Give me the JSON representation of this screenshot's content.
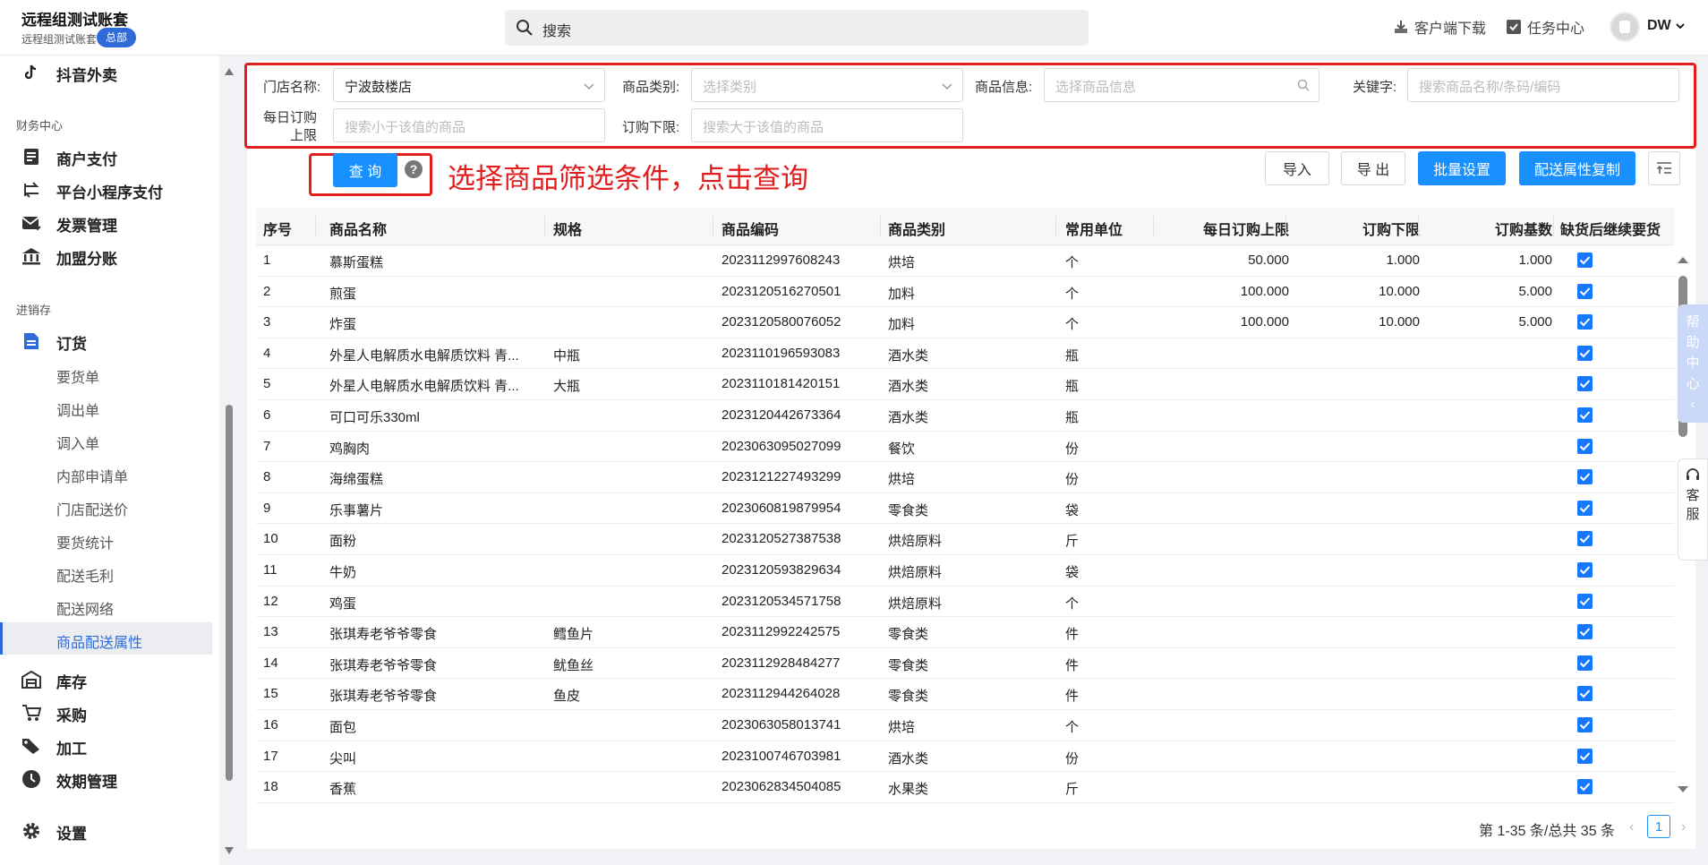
{
  "account": {
    "name": "远程组测试账套",
    "sub": "远程组测试账套",
    "badge": "总部"
  },
  "search": {
    "placeholder": "搜索"
  },
  "top_actions": {
    "download": "客户端下载",
    "tasks": "任务中心",
    "user": "DW"
  },
  "sidebar": {
    "items_top": [
      {
        "label": "抖音外卖",
        "icon": "tiktok-icon"
      }
    ],
    "section_finance": "财务中心",
    "finance": [
      {
        "label": "商户支付",
        "icon": "receipt-icon"
      },
      {
        "label": "平台小程序支付",
        "icon": "swap-icon"
      },
      {
        "label": "发票管理",
        "icon": "envelope-icon"
      },
      {
        "label": "加盟分账",
        "icon": "bank-icon"
      }
    ],
    "section_inventory": "进销存",
    "order": {
      "label": "订货",
      "icon": "document-icon"
    },
    "order_sub": [
      "要货单",
      "调出单",
      "调入单",
      "内部申请单",
      "门店配送价",
      "要货统计",
      "配送毛利",
      "配送网络",
      "商品配送属性"
    ],
    "active_sub": "商品配送属性",
    "bottom": [
      {
        "label": "库存",
        "icon": "warehouse-icon"
      },
      {
        "label": "采购",
        "icon": "cart-icon"
      },
      {
        "label": "加工",
        "icon": "tag-icon"
      },
      {
        "label": "效期管理",
        "icon": "clock-icon"
      }
    ],
    "settings": {
      "label": "设置",
      "icon": "gear-icon"
    }
  },
  "filters": {
    "store_label": "门店名称:",
    "store_value": "宁波鼓楼店",
    "category_label": "商品类别:",
    "category_placeholder": "选择类别",
    "info_label": "商品信息:",
    "info_placeholder": "选择商品信息",
    "keyword_label": "关键字:",
    "keyword_placeholder": "搜索商品名称/条码/编码",
    "daily_label_1": "每日订购",
    "daily_label_2": "上限",
    "daily_placeholder": "搜索小于该值的商品",
    "min_label": "订购下限:",
    "min_placeholder": "搜索大于该值的商品"
  },
  "toolbar": {
    "query": "查 询",
    "help": "?",
    "hint": "选择商品筛选条件，点击查询",
    "import": "导入",
    "export": "导 出",
    "batch": "批量设置",
    "copy": "配送属性复制"
  },
  "table": {
    "headers": [
      "序号",
      "商品名称",
      "规格",
      "商品编码",
      "商品类别",
      "常用单位",
      "每日订购上限",
      "订购下限",
      "订购基数",
      "缺货后继续要货"
    ],
    "rows": [
      {
        "no": "1",
        "name": "慕斯蛋糕",
        "spec": "",
        "code": "2023112997608243",
        "cat": "烘培",
        "unit": "个",
        "daily": "50.000",
        "min": "1.000",
        "base": "1.000"
      },
      {
        "no": "2",
        "name": "煎蛋",
        "spec": "",
        "code": "2023120516270501",
        "cat": "加料",
        "unit": "个",
        "daily": "100.000",
        "min": "10.000",
        "base": "5.000"
      },
      {
        "no": "3",
        "name": "炸蛋",
        "spec": "",
        "code": "2023120580076052",
        "cat": "加料",
        "unit": "个",
        "daily": "100.000",
        "min": "10.000",
        "base": "5.000"
      },
      {
        "no": "4",
        "name": "外星人电解质水电解质饮料 青...",
        "spec": "中瓶",
        "code": "2023110196593083",
        "cat": "酒水类",
        "unit": "瓶",
        "daily": "",
        "min": "",
        "base": ""
      },
      {
        "no": "5",
        "name": "外星人电解质水电解质饮料 青...",
        "spec": "大瓶",
        "code": "2023110181420151",
        "cat": "酒水类",
        "unit": "瓶",
        "daily": "",
        "min": "",
        "base": ""
      },
      {
        "no": "6",
        "name": "可口可乐330ml",
        "spec": "",
        "code": "2023120442673364",
        "cat": "酒水类",
        "unit": "瓶",
        "daily": "",
        "min": "",
        "base": ""
      },
      {
        "no": "7",
        "name": "鸡胸肉",
        "spec": "",
        "code": "2023063095027099",
        "cat": "餐饮",
        "unit": "份",
        "daily": "",
        "min": "",
        "base": ""
      },
      {
        "no": "8",
        "name": "海绵蛋糕",
        "spec": "",
        "code": "2023121227493299",
        "cat": "烘培",
        "unit": "份",
        "daily": "",
        "min": "",
        "base": ""
      },
      {
        "no": "9",
        "name": "乐事薯片",
        "spec": "",
        "code": "2023060819879954",
        "cat": "零食类",
        "unit": "袋",
        "daily": "",
        "min": "",
        "base": ""
      },
      {
        "no": "10",
        "name": "面粉",
        "spec": "",
        "code": "2023120527387538",
        "cat": "烘焙原料",
        "unit": "斤",
        "daily": "",
        "min": "",
        "base": ""
      },
      {
        "no": "11",
        "name": "牛奶",
        "spec": "",
        "code": "2023120593829634",
        "cat": "烘焙原料",
        "unit": "袋",
        "daily": "",
        "min": "",
        "base": ""
      },
      {
        "no": "12",
        "name": "鸡蛋",
        "spec": "",
        "code": "2023120534571758",
        "cat": "烘焙原料",
        "unit": "个",
        "daily": "",
        "min": "",
        "base": ""
      },
      {
        "no": "13",
        "name": "张琪寿老爷爷零食",
        "spec": "鳕鱼片",
        "code": "2023112992242575",
        "cat": "零食类",
        "unit": "件",
        "daily": "",
        "min": "",
        "base": ""
      },
      {
        "no": "14",
        "name": "张琪寿老爷爷零食",
        "spec": "鱿鱼丝",
        "code": "2023112928484277",
        "cat": "零食类",
        "unit": "件",
        "daily": "",
        "min": "",
        "base": ""
      },
      {
        "no": "15",
        "name": "张琪寿老爷爷零食",
        "spec": "鱼皮",
        "code": "2023112944264028",
        "cat": "零食类",
        "unit": "件",
        "daily": "",
        "min": "",
        "base": ""
      },
      {
        "no": "16",
        "name": "面包",
        "spec": "",
        "code": "2023063058013741",
        "cat": "烘培",
        "unit": "个",
        "daily": "",
        "min": "",
        "base": ""
      },
      {
        "no": "17",
        "name": "尖叫",
        "spec": "",
        "code": "2023100746703981",
        "cat": "酒水类",
        "unit": "份",
        "daily": "",
        "min": "",
        "base": ""
      },
      {
        "no": "18",
        "name": "香蕉",
        "spec": "",
        "code": "2023062834504085",
        "cat": "水果类",
        "unit": "斤",
        "daily": "",
        "min": "",
        "base": ""
      }
    ]
  },
  "pager": {
    "summary": "第 1-35 条/总共 35 条",
    "current": "1",
    "prev": "‹",
    "next": "›"
  },
  "floaters": {
    "help": [
      "帮",
      "助",
      "中",
      "心",
      "‹"
    ],
    "service": [
      "客",
      "服"
    ]
  },
  "colors": {
    "primary": "#1890ff",
    "accent": "#2f6bd8",
    "highlight": "#e01e1e",
    "checkbox": "#1677ff"
  }
}
